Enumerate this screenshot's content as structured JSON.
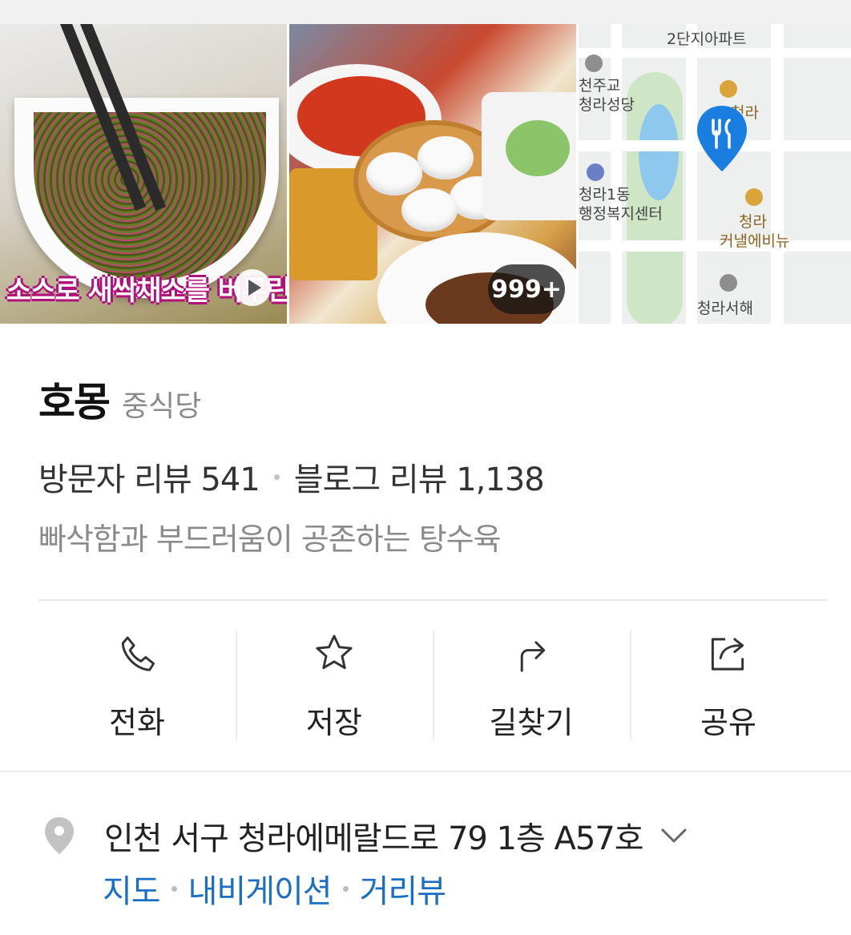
{
  "gallery": {
    "video_caption": "소스로 새싹채소를 버무린",
    "photo_count": "999+",
    "map_labels": [
      "2단지아파트",
      "천주교",
      "청라성당",
      "청라",
      "청라1동",
      "행정복지센터",
      "청라",
      "커낼에비뉴",
      "청라서해"
    ]
  },
  "place": {
    "name": "호몽",
    "category": "중식당"
  },
  "reviews": {
    "visitor": "방문자 리뷰 541",
    "blog": "블로그 리뷰 1,138"
  },
  "tagline": "빠삭함과 부드러움이 공존하는 탕수육",
  "actions": [
    {
      "label": "전화",
      "icon": "phone-icon"
    },
    {
      "label": "저장",
      "icon": "star-icon"
    },
    {
      "label": "길찾기",
      "icon": "directions-icon"
    },
    {
      "label": "공유",
      "icon": "share-icon"
    }
  ],
  "address": {
    "text": "인천 서구 청라에메랄드로 79 1층 A57호",
    "links": [
      "지도",
      "내비게이션",
      "거리뷰"
    ]
  },
  "colors": {
    "link": "#1a6fc4",
    "pin": "#1a7de0",
    "muted": "#8a8a8a"
  }
}
